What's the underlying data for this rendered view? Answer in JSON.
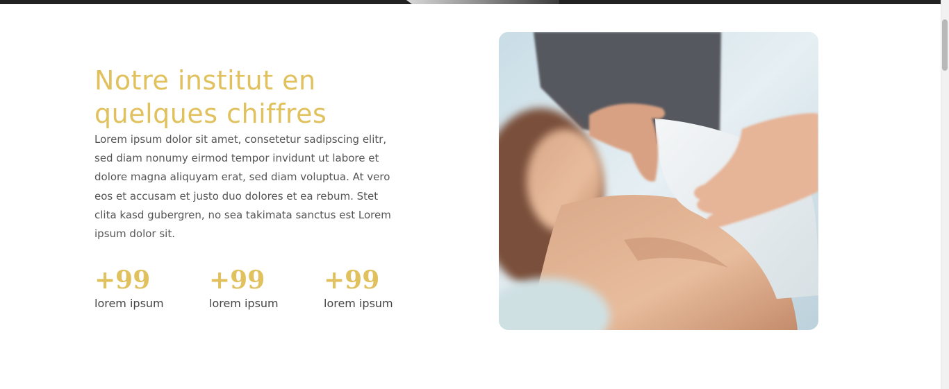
{
  "section": {
    "title": "Notre institut en quelques chiffres",
    "description": "Lorem ipsum dolor sit amet, consetetur sadipscing elitr, sed diam nonumy eirmod tempor invidunt ut labore et dolore magna aliquyam erat, sed diam voluptua. At vero eos et accusam et justo duo dolores et ea rebum. Stet clita kasd gubergren, no sea takimata sanctus est Lorem ipsum dolor sit.",
    "stats": [
      {
        "value": "+99",
        "label": "lorem ipsum"
      },
      {
        "value": "+99",
        "label": "lorem ipsum"
      },
      {
        "value": "+99",
        "label": "lorem ipsum"
      }
    ]
  },
  "colors": {
    "accent": "#e0c15e",
    "body_text": "#555555",
    "top_band": "#222222"
  },
  "image": {
    "icon": "massage-photo"
  }
}
